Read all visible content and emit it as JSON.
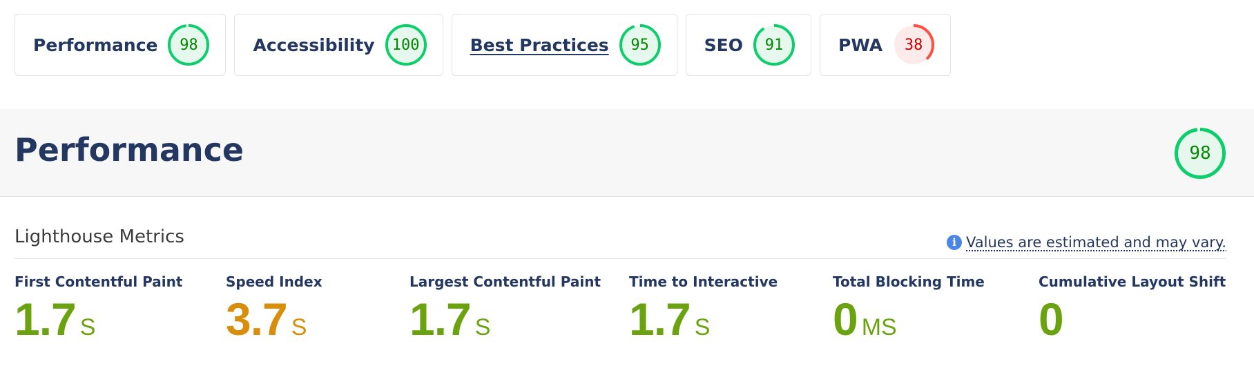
{
  "tabs": [
    {
      "label": "Performance",
      "score": 98,
      "status": "pass"
    },
    {
      "label": "Accessibility",
      "score": 100,
      "status": "pass"
    },
    {
      "label": "Best Practices",
      "score": 95,
      "status": "pass"
    },
    {
      "label": "SEO",
      "score": 91,
      "status": "pass"
    },
    {
      "label": "PWA",
      "score": 38,
      "status": "fail"
    }
  ],
  "section": {
    "title": "Performance",
    "score": 98
  },
  "metrics_header": {
    "title": "Lighthouse Metrics",
    "note": "Values are estimated and may vary.",
    "note_icon": "info-icon"
  },
  "metrics": [
    {
      "label": "First Contentful Paint",
      "value": "1.7",
      "unit": "S",
      "rating": "good"
    },
    {
      "label": "Speed Index",
      "value": "3.7",
      "unit": "S",
      "rating": "average"
    },
    {
      "label": "Largest Contentful Paint",
      "value": "1.7",
      "unit": "S",
      "rating": "good"
    },
    {
      "label": "Time to Interactive",
      "value": "1.7",
      "unit": "S",
      "rating": "good"
    },
    {
      "label": "Total Blocking Time",
      "value": "0",
      "unit": "MS",
      "rating": "good"
    },
    {
      "label": "Cumulative Layout Shift",
      "value": "0",
      "unit": "",
      "rating": "good"
    }
  ],
  "colors": {
    "pass_ring": "#0cce6b",
    "pass_fill": "#e6f8ee",
    "pass_text": "#008800",
    "fail_ring": "#ff4e42",
    "fail_fill": "#fdeaea",
    "fail_text": "#cc0000",
    "good_metric": "#6aa30f",
    "average_metric": "#d98e0b",
    "navy": "#243760"
  }
}
